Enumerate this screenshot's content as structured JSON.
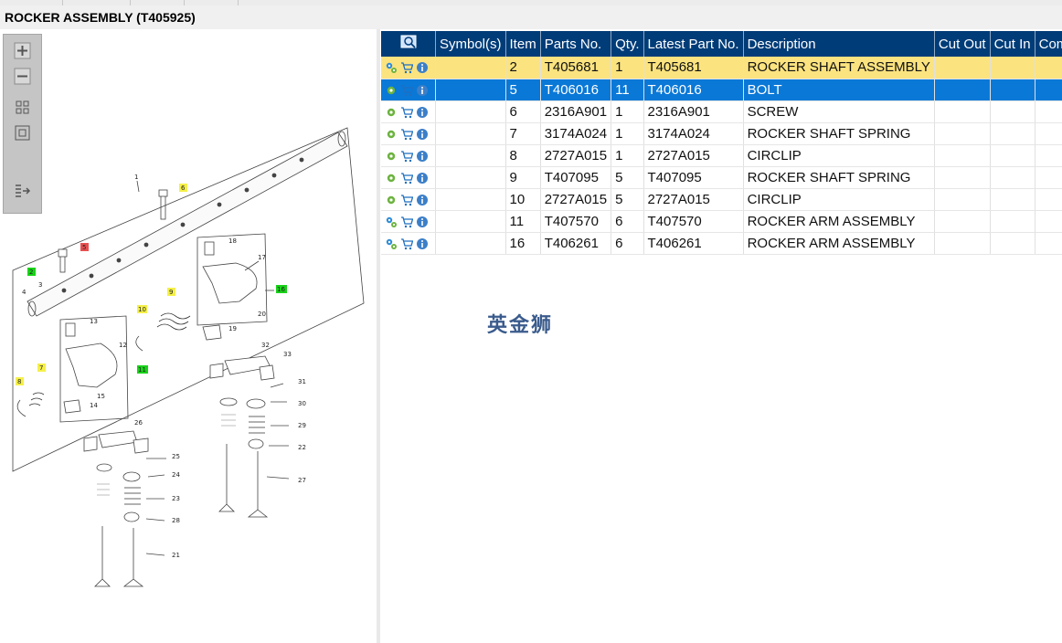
{
  "window": {
    "title": "ROCKER ASSEMBLY (T405925)"
  },
  "zoom_tools": {
    "zoom_in": "zoom-in-icon",
    "zoom_out": "zoom-out-icon",
    "fit_all": "fit-all-icon",
    "fit_window": "fit-window-icon",
    "toggle_panel": "panel-toggle-icon"
  },
  "table": {
    "columns": [
      "Symbol(s)",
      "Item",
      "Parts No.",
      "Qty.",
      "Latest Part No.",
      "Description",
      "Cut Out",
      "Cut In",
      "Comment"
    ],
    "rows": [
      {
        "item": "2",
        "part_no": "T405681",
        "qty": "1",
        "latest": "T405681",
        "desc": "ROCKER SHAFT ASSEMBLY",
        "cut_out": "",
        "cut_in": "",
        "comment": "",
        "icon": "gears"
      },
      {
        "item": "5",
        "part_no": "T406016",
        "qty": "11",
        "latest": "T406016",
        "desc": "BOLT",
        "cut_out": "",
        "cut_in": "",
        "comment": "",
        "icon": "gear"
      },
      {
        "item": "6",
        "part_no": "2316A901",
        "qty": "1",
        "latest": "2316A901",
        "desc": "SCREW",
        "cut_out": "",
        "cut_in": "",
        "comment": "",
        "icon": "gear"
      },
      {
        "item": "7",
        "part_no": "3174A024",
        "qty": "1",
        "latest": "3174A024",
        "desc": "ROCKER SHAFT SPRING",
        "cut_out": "",
        "cut_in": "",
        "comment": "",
        "icon": "gear"
      },
      {
        "item": "8",
        "part_no": "2727A015",
        "qty": "1",
        "latest": "2727A015",
        "desc": "CIRCLIP",
        "cut_out": "",
        "cut_in": "",
        "comment": "",
        "icon": "gear"
      },
      {
        "item": "9",
        "part_no": "T407095",
        "qty": "5",
        "latest": "T407095",
        "desc": "ROCKER SHAFT SPRING",
        "cut_out": "",
        "cut_in": "",
        "comment": "",
        "icon": "gear"
      },
      {
        "item": "10",
        "part_no": "2727A015",
        "qty": "5",
        "latest": "2727A015",
        "desc": "CIRCLIP",
        "cut_out": "",
        "cut_in": "",
        "comment": "",
        "icon": "gear"
      },
      {
        "item": "11",
        "part_no": "T407570",
        "qty": "6",
        "latest": "T407570",
        "desc": "ROCKER ARM ASSEMBLY",
        "cut_out": "",
        "cut_in": "",
        "comment": "",
        "icon": "gears"
      },
      {
        "item": "16",
        "part_no": "T406261",
        "qty": "6",
        "latest": "T406261",
        "desc": "ROCKER ARM ASSEMBLY",
        "cut_out": "",
        "cut_in": "",
        "comment": "",
        "icon": "gears"
      }
    ]
  },
  "watermark": "英金狮",
  "diagram": {
    "callouts": [
      "1",
      "2",
      "3",
      "4",
      "5",
      "6",
      "7",
      "8",
      "9",
      "10",
      "11",
      "12",
      "13",
      "14",
      "15",
      "16",
      "17",
      "18",
      "19",
      "20",
      "21",
      "22",
      "23",
      "24",
      "25",
      "26",
      "27",
      "28",
      "29",
      "30",
      "31",
      "32",
      "33"
    ],
    "highlight_colors": {
      "yellow": "#f5f04a",
      "green": "#19d219",
      "red": "#e85050"
    }
  },
  "colors": {
    "header_bg": "#003c78",
    "row_highlight_yellow": "#fbe37f",
    "row_selected_blue": "#0a78d7"
  }
}
